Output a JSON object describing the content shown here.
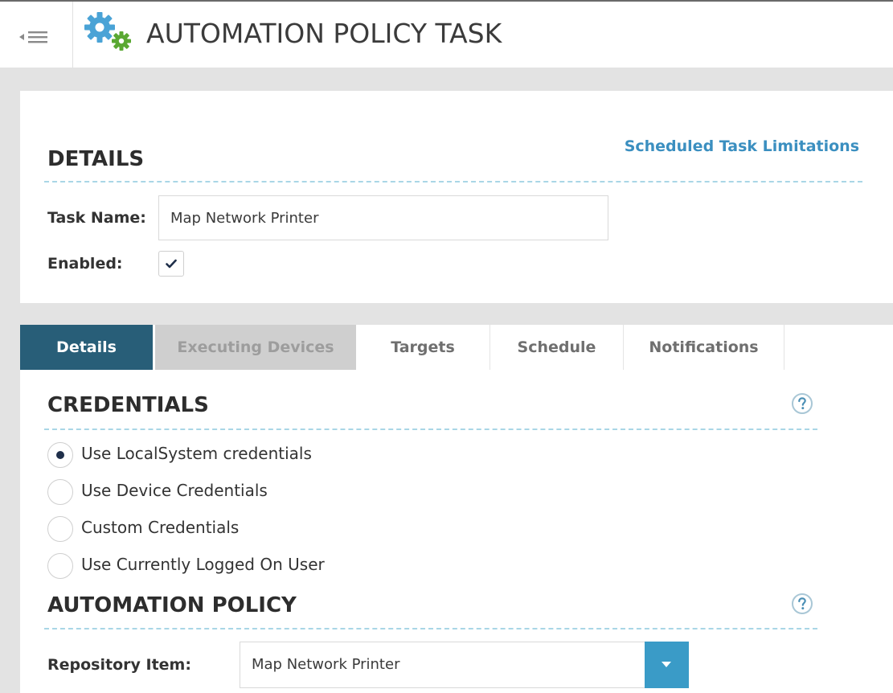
{
  "header": {
    "title": "AUTOMATION POLICY TASK",
    "menu_icon": "menu-collapse-icon",
    "app_icon": "gears-icon"
  },
  "details_card": {
    "limitations_link": "Scheduled Task Limitations",
    "section_title": "DETAILS",
    "task_name_label": "Task Name:",
    "task_name_value": "Map Network Printer",
    "enabled_label": "Enabled:",
    "enabled_checked": true
  },
  "tabs": [
    {
      "label": "Details",
      "state": "active"
    },
    {
      "label": "Executing Devices",
      "state": "disabled"
    },
    {
      "label": "Targets",
      "state": "normal"
    },
    {
      "label": "Schedule",
      "state": "normal"
    },
    {
      "label": "Notifications",
      "state": "normal"
    }
  ],
  "credentials": {
    "section_title": "CREDENTIALS",
    "help_icon": "question-circle-icon",
    "options": [
      {
        "label": "Use LocalSystem credentials",
        "selected": true
      },
      {
        "label": "Use Device Credentials",
        "selected": false
      },
      {
        "label": "Custom Credentials",
        "selected": false
      },
      {
        "label": "Use Currently Logged On User",
        "selected": false
      }
    ]
  },
  "automation_policy": {
    "section_title": "AUTOMATION POLICY",
    "help_icon": "question-circle-icon",
    "repository_label": "Repository Item:",
    "repository_value": "Map Network Printer"
  },
  "colors": {
    "accent": "#3b8fc0",
    "tab_active": "#285e78",
    "select_caret": "#3a9bc7"
  }
}
